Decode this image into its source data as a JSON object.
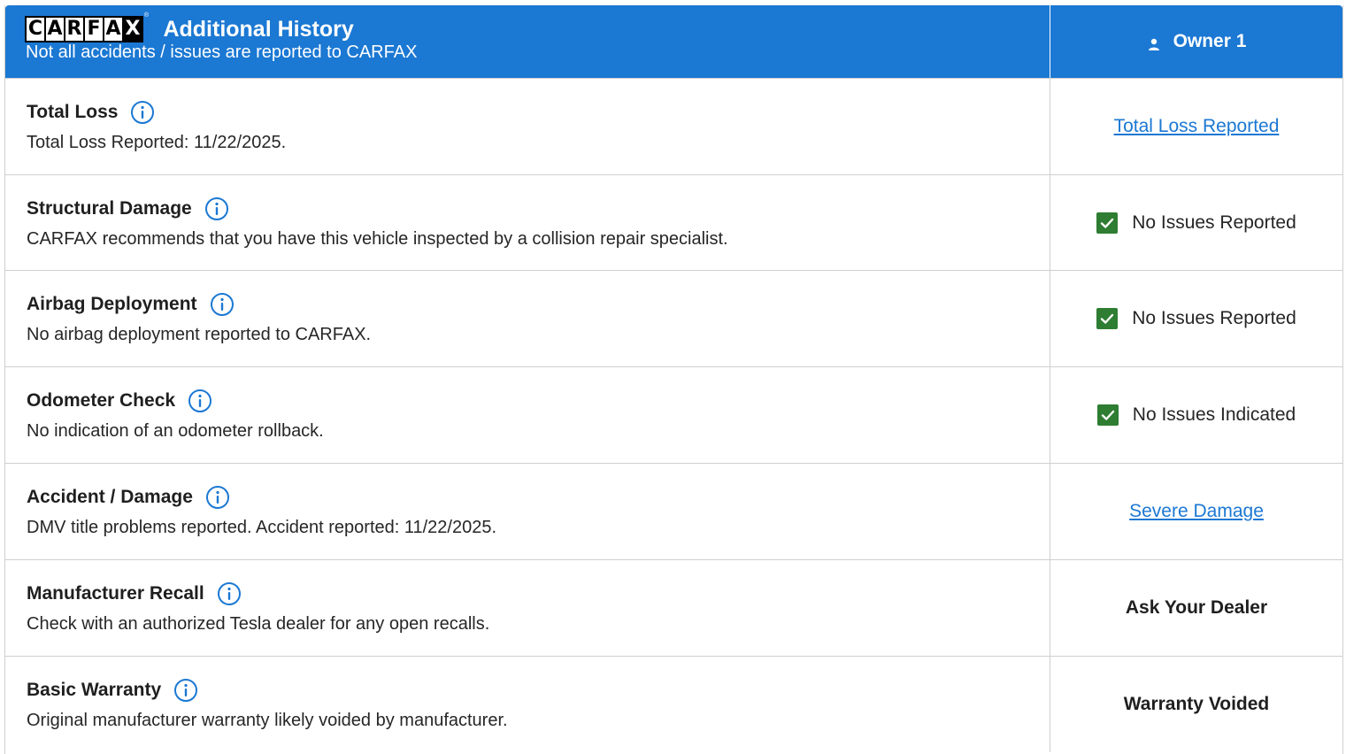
{
  "header": {
    "logo_letters": [
      "C",
      "A",
      "R",
      "F",
      "A",
      "X"
    ],
    "title": "Additional History",
    "subtitle": "Not all accidents / issues are reported to CARFAX",
    "owner_label": "Owner 1"
  },
  "colors": {
    "header_bg": "#1b78d3",
    "link": "#1b78d3",
    "check": "#2e7d32"
  },
  "rows": [
    {
      "title": "Total Loss",
      "description": "Total Loss Reported: 11/22/2025.",
      "status": "Total Loss Reported",
      "status_kind": "link"
    },
    {
      "title": "Structural Damage",
      "description": "CARFAX recommends that you have this vehicle inspected by a collision repair specialist.",
      "status": "No Issues Reported",
      "status_kind": "check"
    },
    {
      "title": "Airbag Deployment",
      "description": "No airbag deployment reported to CARFAX.",
      "status": "No Issues Reported",
      "status_kind": "check"
    },
    {
      "title": "Odometer Check",
      "description": "No indication of an odometer rollback.",
      "status": "No Issues Indicated",
      "status_kind": "check"
    },
    {
      "title": "Accident / Damage",
      "description": "DMV title problems reported. Accident reported: 11/22/2025.",
      "status": "Severe Damage",
      "status_kind": "link"
    },
    {
      "title": "Manufacturer Recall",
      "description": "Check with an authorized Tesla dealer for any open recalls.",
      "status": "Ask Your Dealer",
      "status_kind": "bold"
    },
    {
      "title": "Basic Warranty",
      "description": "Original manufacturer warranty likely voided by manufacturer.",
      "status": "Warranty Voided",
      "status_kind": "bold"
    }
  ]
}
